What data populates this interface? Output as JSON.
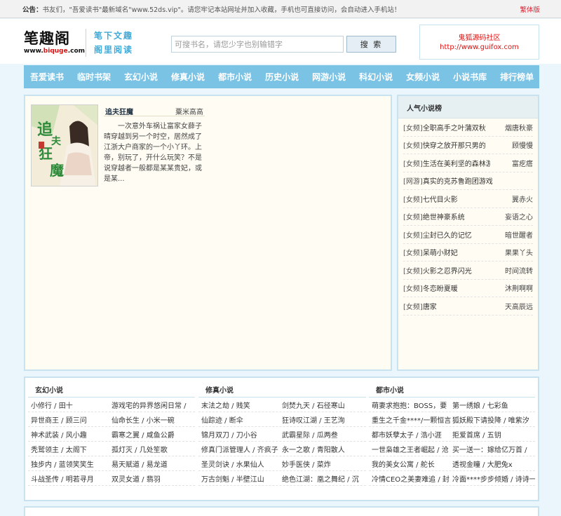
{
  "topbar": {
    "notice_label": "公告：",
    "notice_text": "书友们，\"吾爱读书\"最新域名\"www.52ds.vip\"。请您牢记本站网址并加入收藏，手机也可直接访问，会自动进入手机站！",
    "trad_label": "繁体版"
  },
  "header": {
    "logo_cn": "笔趣阁",
    "logo_en_a": "www.",
    "logo_en_b": "biquge",
    "logo_en_c": ".com",
    "slogan_1": "笔下文趣",
    "slogan_2": "阁里阅读",
    "search_placeholder": "可搜书名，请您少字也别输错字",
    "search_button": "搜 索",
    "ad_line1": "鬼狐源码社区",
    "ad_line2": "http://www.guifox.com"
  },
  "nav": [
    "吾爱读书",
    "临时书架",
    "玄幻小说",
    "修真小说",
    "都市小说",
    "历史小说",
    "网游小说",
    "科幻小说",
    "女频小说",
    "小说书库",
    "排行榜单"
  ],
  "featured": {
    "title": "追夫狂魔",
    "author": "粟米高高",
    "desc": "一次意外车祸让富家女薛子晴穿越到另一个时空，居然成了江浙大户商家的一个小丫环。上帝，别玩了，开什么玩笑？不是说穿越者一般都是某某贵妃，或是某...",
    "cover_text": "追夫狂魔"
  },
  "side": {
    "title": "人气小说榜",
    "items": [
      {
        "tag": "[女频]",
        "name": "全职高手之叶蒲双秋",
        "author": "烟唐秋豪"
      },
      {
        "tag": "[女频]",
        "name": "快穿之放开那只男的",
        "author": "顾慢慢"
      },
      {
        "tag": "[女频]",
        "name": "生活在美利坚的森林游侠",
        "author": "富疙瘩"
      },
      {
        "tag": "[网游]",
        "name": "真实的克苏鲁跑团游戏",
        "author": ""
      },
      {
        "tag": "[女频]",
        "name": "七代目火影",
        "author": "翼赤火"
      },
      {
        "tag": "[女频]",
        "name": "绝世神豪系统",
        "author": "妄语之心"
      },
      {
        "tag": "[女频]",
        "name": "尘封已久的记忆",
        "author": "暗世醒者"
      },
      {
        "tag": "[女频]",
        "name": "呆萌小财妃",
        "author": "果果丫头"
      },
      {
        "tag": "[女频]",
        "name": "火影之忍界闪光",
        "author": "时间流转"
      },
      {
        "tag": "[女频]",
        "name": "冬恋盼夏暖",
        "author": "沐荆啊啊"
      },
      {
        "tag": "[女频]",
        "name": "唐家",
        "author": "天高辰远"
      }
    ]
  },
  "categories": [
    {
      "title": "玄幻小说",
      "rows": [
        [
          "小修行 / 田十",
          "游戏宅的异界悠闲日常 /"
        ],
        [
          "异世商王 / 顾三问",
          "仙命长生 / 小米一碗"
        ],
        [
          "神术武装 / 风小趣",
          "霸寒之翼 / 咸鱼公爵"
        ],
        [
          "秃鹫领主 / 太阁下",
          "孤灯灭 / 几处笙歌"
        ],
        [
          "独步内 / 蓝领笑笑生",
          "易天赋道 / 易龙道"
        ],
        [
          "斗战圣传 / 明若寻月",
          "双灵女道 / 翡羽"
        ]
      ]
    },
    {
      "title": "修真小说",
      "rows": [
        [
          "末法之劫 / 贱笑",
          "剑焚九天 / 石径寒山"
        ],
        [
          "仙踪迹 / 断伞",
          "狂诗叹江湖 / 王艺洵"
        ],
        [
          "锦月双刀 / 刀小谷",
          "武霸星际 / 瓜两叁"
        ],
        [
          "修真门派管理人 / 齐疯子",
          "永一之歌 / 青阳散人"
        ],
        [
          "圣灵剑诀 / 水果仙人",
          "妙手医侠 / 菜炸"
        ],
        [
          "万古剑魁 / 半壁江山",
          "绝色江湖：凰之舞纪 / 沉"
        ]
      ]
    },
    {
      "title": "都市小说",
      "rows": [
        [
          "萌妻求抱抱：BOSS，要",
          "第一绣娘 / 七彩鱼"
        ],
        [
          "重生之千金****/一颗恒言",
          "狐妖殿下请投降 / 唯紫汐"
        ],
        [
          "都市妖孽太子 / 浩小涯",
          "拒爱首席 / 五钥"
        ],
        [
          "一世枭雄之王者崛起 / 沧",
          "买一送一：嫁给亿万首 /"
        ],
        [
          "我的美女公寓 / 舵长",
          "透视金瞳 / 大肥兔x"
        ],
        [
          "冷情CEO之美妻难追 / 封",
          "冷面****步步倾婚 / 诗诗一"
        ]
      ]
    }
  ],
  "colors": {
    "nav_bg": "#7bc3e5",
    "accent_red": "#dd1111",
    "panel_bg": "#fffdf3",
    "page_bg": "#eaf6fc"
  }
}
